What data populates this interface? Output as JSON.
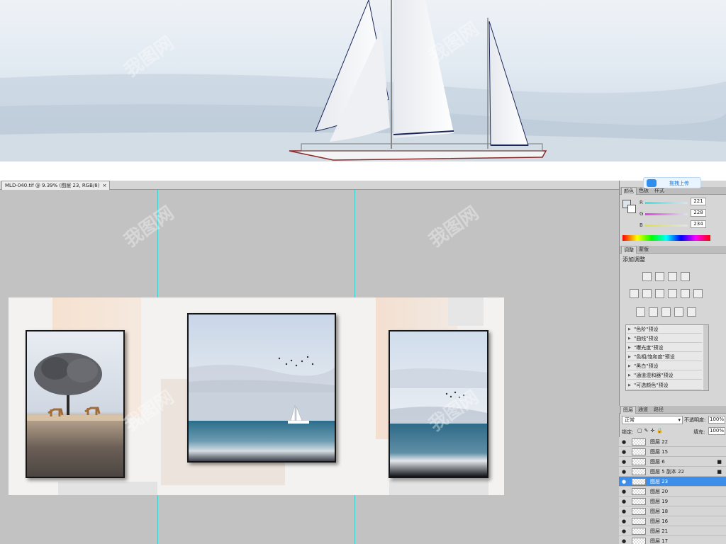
{
  "document_tab": {
    "title": "MLD-040.tif @ 9.39% (图层 23, RGB/8)",
    "close": "×"
  },
  "upload_button": {
    "label": "拖拽上传"
  },
  "color_panel": {
    "tabs": [
      "颜色",
      "色板",
      "样式"
    ],
    "r_label": "R",
    "g_label": "G",
    "b_label": "B",
    "r_value": "221",
    "g_value": "228",
    "b_value": "234",
    "r_color": "#40c8c8",
    "g_color": "#c040c0",
    "b_color": "#c8c840",
    "foreground_color": "#dde4ea"
  },
  "adjustments_panel": {
    "tabs": [
      "调整",
      "蒙版"
    ],
    "title": "添加调整",
    "icons": [
      "brightness-icon",
      "levels-icon",
      "curves-icon",
      "exposure-icon",
      "vibrance-icon",
      "hue-saturation-icon",
      "color-balance-icon",
      "black-white-icon",
      "photo-filter-icon",
      "channel-mixer-icon",
      "invert-icon",
      "posterize-icon",
      "threshold-icon",
      "gradient-map-icon",
      "selective-color-icon"
    ],
    "presets": [
      "\"色阶\"预设",
      "\"曲线\"预设",
      "\"曝光度\"预设",
      "\"色相/饱和度\"预设",
      "\"黑白\"预设",
      "\"通道混和器\"预设",
      "\"可选颜色\"预设"
    ]
  },
  "layers_panel": {
    "tabs": [
      "图层",
      "通道",
      "路径"
    ],
    "blend_mode": "正常",
    "opacity_label": "不透明度:",
    "opacity_value": "100%",
    "lock_label": "锁定:",
    "fill_label": "填充:",
    "fill_value": "100%",
    "layers": [
      {
        "name": "图层 22",
        "locked": false,
        "selected": false
      },
      {
        "name": "图层 15",
        "locked": false,
        "selected": false
      },
      {
        "name": "图层 6",
        "locked": true,
        "selected": false
      },
      {
        "name": "图层 5 副本 22",
        "locked": true,
        "selected": false
      },
      {
        "name": "图层 23",
        "locked": false,
        "selected": true
      },
      {
        "name": "图层 20",
        "locked": false,
        "selected": false
      },
      {
        "name": "图层 19",
        "locked": false,
        "selected": false
      },
      {
        "name": "图层 18",
        "locked": false,
        "selected": false
      },
      {
        "name": "图层 16",
        "locked": false,
        "selected": false
      },
      {
        "name": "图层 21",
        "locked": false,
        "selected": false
      },
      {
        "name": "图层 17",
        "locked": false,
        "selected": false
      }
    ]
  },
  "watermark": "我图网",
  "colors": {
    "selected": "#3d8ee8",
    "guide": "#3ed1d1",
    "canvas_bg": "#c2c2c2"
  }
}
